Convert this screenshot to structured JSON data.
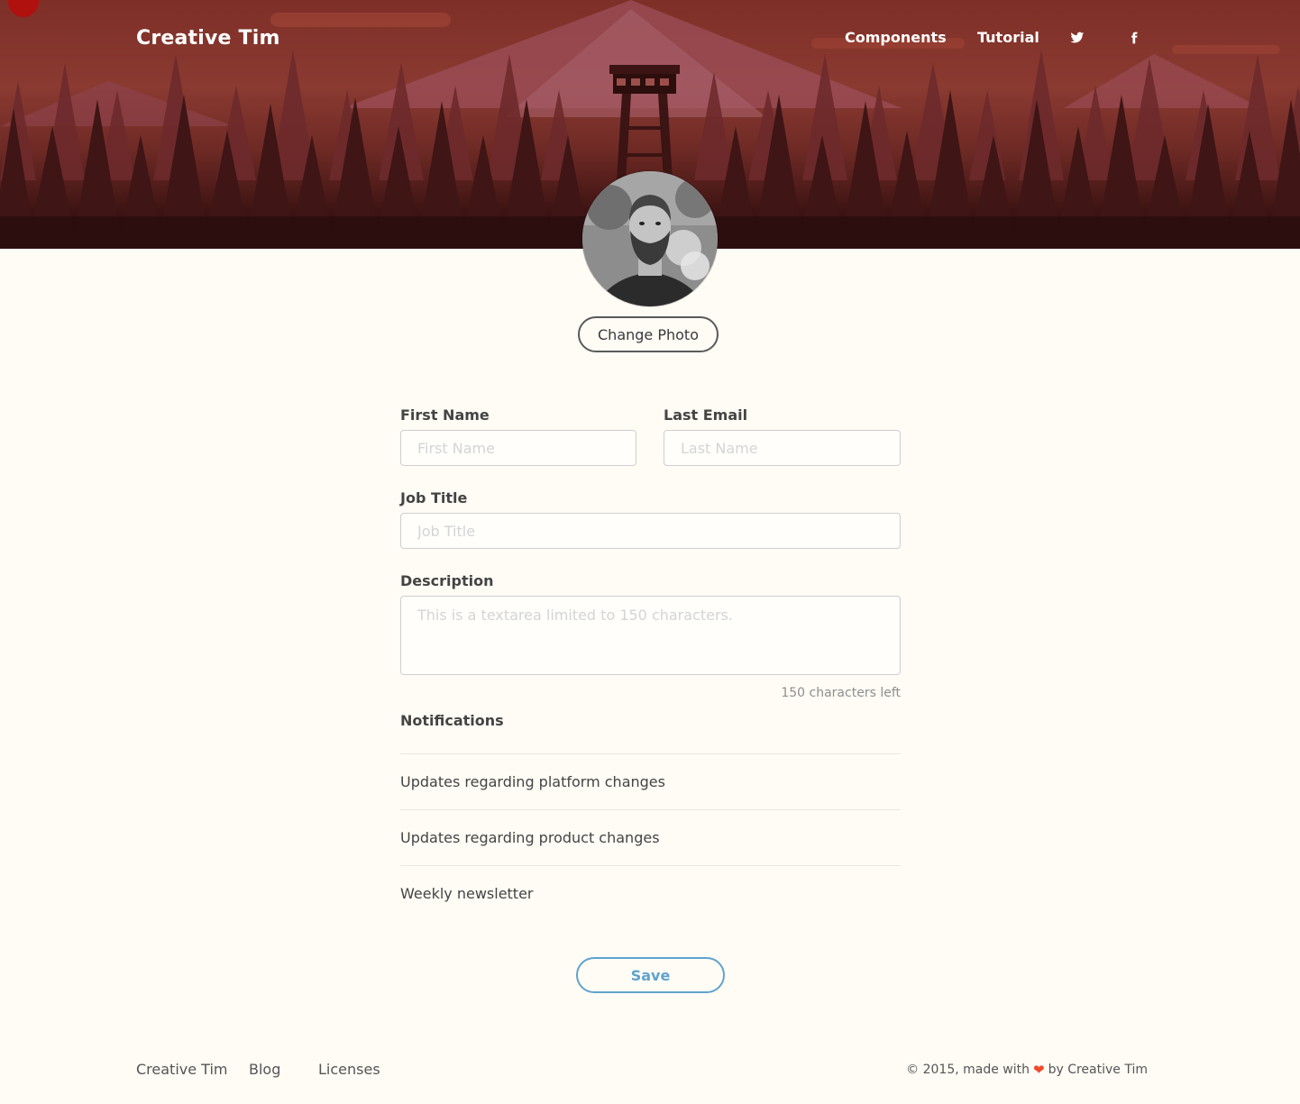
{
  "header": {
    "brand": "Creative Tim",
    "nav": {
      "components": "Components",
      "tutorial": "Tutorial"
    },
    "icons": [
      "twitter-icon",
      "facebook-icon"
    ]
  },
  "profile": {
    "change_photo_label": "Change Photo"
  },
  "form": {
    "first_name": {
      "label": "First Name",
      "placeholder": "First Name",
      "value": ""
    },
    "last_name": {
      "label": "Last Email",
      "placeholder": "Last Name",
      "value": ""
    },
    "job_title": {
      "label": "Job Title",
      "placeholder": "Job Title",
      "value": ""
    },
    "description": {
      "label": "Description",
      "placeholder": "This is a textarea limited to 150 characters.",
      "value": "",
      "chars_left": "150 characters left"
    },
    "notifications": {
      "title": "Notifications",
      "items": [
        "Updates regarding platform changes",
        "Updates regarding product changes",
        "Weekly newsletter"
      ]
    },
    "save_label": "Save"
  },
  "footer": {
    "links": [
      "Creative Tim",
      "Blog",
      "Licenses"
    ],
    "copyright_prefix": "© 2015, made with",
    "copyright_suffix": "by Creative Tim"
  },
  "colors": {
    "accent": "#5fa3cf",
    "header_red": "#7e2f27",
    "heart": "#f0492a",
    "background": "#fffcf5"
  }
}
